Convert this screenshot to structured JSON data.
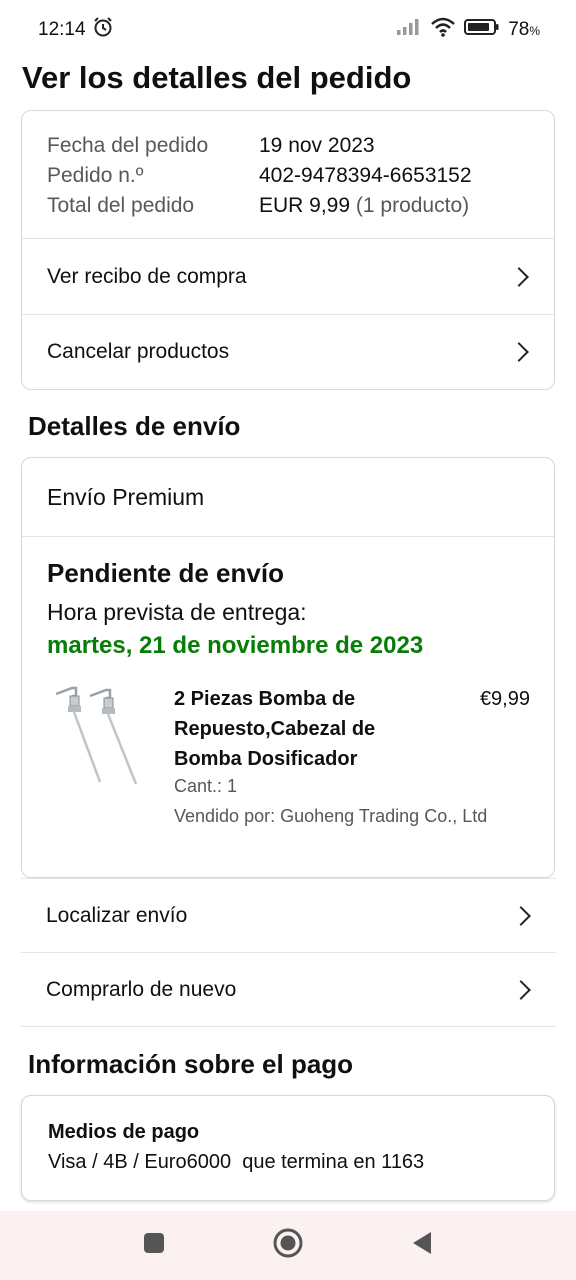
{
  "status_bar": {
    "time": "12:14",
    "battery": "78",
    "icons": [
      "alarm-icon",
      "signal-icon",
      "wifi-icon",
      "battery-icon"
    ]
  },
  "page": {
    "title": "Ver los detalles del pedido"
  },
  "order": {
    "date_label": "Fecha del pedido",
    "date_value": "19 nov 2023",
    "number_label": "Pedido n.º",
    "number_value": "402-9478394-6653152",
    "total_label": "Total del pedido",
    "total_value": "EUR 9,99",
    "total_count": "(1 producto)",
    "receipt_link": "Ver recibo de compra",
    "cancel_link": "Cancelar productos"
  },
  "shipping": {
    "section_title": "Detalles de envío",
    "type": "Envío Premium",
    "status": "Pendiente de envío",
    "eta_label": "Hora prevista de entrega:",
    "eta_date": "martes, 21 de noviembre de 2023",
    "product": {
      "title": "2 Piezas Bomba de Repuesto,Cabezal de Bomba Dosificador",
      "price": "€9,99",
      "qty": "Cant.: 1",
      "seller": "Vendido por: Guoheng Trading Co., Ltd"
    },
    "track_link": "Localizar envío",
    "rebuy_link": "Comprarlo de nuevo"
  },
  "payment": {
    "section_title": "Información sobre el pago",
    "methods_label": "Medios de pago",
    "method_value": "Visa / 4B / Euro6000  que termina en 1163"
  },
  "colors": {
    "eta_green": "#067d06",
    "border": "#d5d9d9",
    "muted_text": "#565959",
    "nav_bg": "#fbf1f0"
  }
}
